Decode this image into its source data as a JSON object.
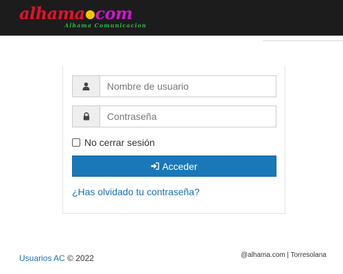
{
  "header": {
    "logo_text_main": "alhama",
    "logo_text_com": "com",
    "logo_tagline": "Alhama Comunicacion"
  },
  "login": {
    "username_placeholder": "Nombre de usuario",
    "username_icon": "user-icon",
    "password_placeholder": "Contraseña",
    "password_icon": "lock-icon",
    "remember_label": "No cerrar sesión",
    "remember_checked": false,
    "submit_label": "Acceder",
    "submit_icon": "sign-in-icon",
    "forgot_link": "¿Has olvidado tu contraseña?"
  },
  "footer": {
    "left_link": "Usuarios AC",
    "left_copyright": "© 2022",
    "right_text": "@alhama.com | Torresolana"
  },
  "colors": {
    "header_bg": "#1c1c1c",
    "logo_red": "#e8102a",
    "logo_magenta": "#c81acb",
    "logo_yellow": "#f4c600",
    "logo_green": "#2db84a",
    "button_blue": "#1a78b8",
    "link_blue": "#1a6fb3"
  }
}
